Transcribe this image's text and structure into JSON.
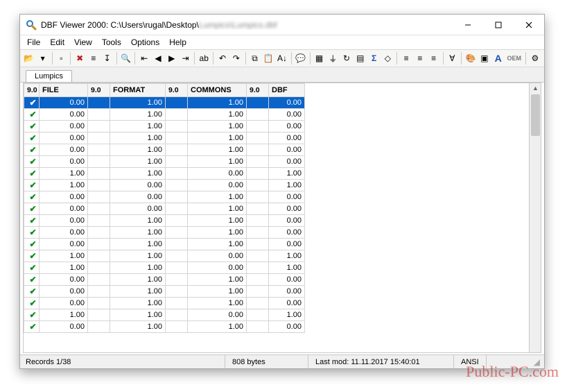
{
  "watermark": "Public-PC.com",
  "titlebar": {
    "title_prefix": "DBF Viewer 2000: C:\\Users\\rugal\\Desktop\\",
    "title_blurred": "Lumpics\\Lumpics.dbf"
  },
  "menubar": [
    {
      "label": "File"
    },
    {
      "label": "Edit"
    },
    {
      "label": "View"
    },
    {
      "label": "Tools"
    },
    {
      "label": "Options"
    },
    {
      "label": "Help"
    }
  ],
  "toolbar_icons": [
    "open-icon",
    "dropdown-icon",
    "sep",
    "new-icon",
    "sep",
    "delete-icon",
    "cut-icon",
    "export-icon",
    "sep",
    "search-icon",
    "sep",
    "first-icon",
    "prev-icon",
    "next-icon",
    "last-icon",
    "sep",
    "replace-icon",
    "sep",
    "undo-icon",
    "redo-icon",
    "sep",
    "copy-icon",
    "paste-icon",
    "sort-icon",
    "sep",
    "info-icon",
    "sep",
    "filter-icon",
    "filter2-icon",
    "refresh-icon",
    "columns-icon",
    "sum-icon",
    "clear-icon",
    "sep",
    "align-left-icon",
    "align-center-icon",
    "align-right-icon",
    "sep",
    "filter3-icon",
    "sep",
    "palette-icon",
    "highlight-icon",
    "font-icon",
    "oem-icon",
    "sep",
    "settings-icon"
  ],
  "tabs": [
    {
      "label": "Lumpics"
    }
  ],
  "grid": {
    "headers": [
      {
        "type": "9.0",
        "name": "FILE"
      },
      {
        "type": "9.0",
        "name": "FORMAT"
      },
      {
        "type": "9.0",
        "name": "COMMONS"
      },
      {
        "type": "9.0",
        "name": "DBF"
      }
    ],
    "rows": [
      {
        "sel": true,
        "v": [
          "0.00",
          "1.00",
          "1.00",
          "0.00"
        ]
      },
      {
        "sel": false,
        "v": [
          "0.00",
          "1.00",
          "1.00",
          "0.00"
        ]
      },
      {
        "sel": false,
        "v": [
          "0.00",
          "1.00",
          "1.00",
          "0.00"
        ]
      },
      {
        "sel": false,
        "v": [
          "0.00",
          "1.00",
          "1.00",
          "0.00"
        ]
      },
      {
        "sel": false,
        "v": [
          "0.00",
          "1.00",
          "1.00",
          "0.00"
        ]
      },
      {
        "sel": false,
        "v": [
          "0.00",
          "1.00",
          "1.00",
          "0.00"
        ]
      },
      {
        "sel": false,
        "v": [
          "1.00",
          "1.00",
          "0.00",
          "1.00"
        ]
      },
      {
        "sel": false,
        "v": [
          "1.00",
          "0.00",
          "0.00",
          "1.00"
        ]
      },
      {
        "sel": false,
        "v": [
          "0.00",
          "0.00",
          "1.00",
          "0.00"
        ]
      },
      {
        "sel": false,
        "v": [
          "0.00",
          "0.00",
          "1.00",
          "0.00"
        ]
      },
      {
        "sel": false,
        "v": [
          "0.00",
          "1.00",
          "1.00",
          "0.00"
        ]
      },
      {
        "sel": false,
        "v": [
          "0.00",
          "1.00",
          "1.00",
          "0.00"
        ]
      },
      {
        "sel": false,
        "v": [
          "0.00",
          "1.00",
          "1.00",
          "0.00"
        ]
      },
      {
        "sel": false,
        "v": [
          "1.00",
          "1.00",
          "0.00",
          "1.00"
        ]
      },
      {
        "sel": false,
        "v": [
          "1.00",
          "1.00",
          "0.00",
          "1.00"
        ]
      },
      {
        "sel": false,
        "v": [
          "0.00",
          "1.00",
          "1.00",
          "0.00"
        ]
      },
      {
        "sel": false,
        "v": [
          "0.00",
          "1.00",
          "1.00",
          "0.00"
        ]
      },
      {
        "sel": false,
        "v": [
          "0.00",
          "1.00",
          "1.00",
          "0.00"
        ]
      },
      {
        "sel": false,
        "v": [
          "1.00",
          "1.00",
          "0.00",
          "1.00"
        ]
      },
      {
        "sel": false,
        "v": [
          "0.00",
          "1.00",
          "1.00",
          "0.00"
        ]
      }
    ]
  },
  "statusbar": {
    "records": "Records 1/38",
    "size": "808 bytes",
    "lastmod": "Last mod: 11.11.2017 15:40:01",
    "encoding": "ANSI"
  }
}
